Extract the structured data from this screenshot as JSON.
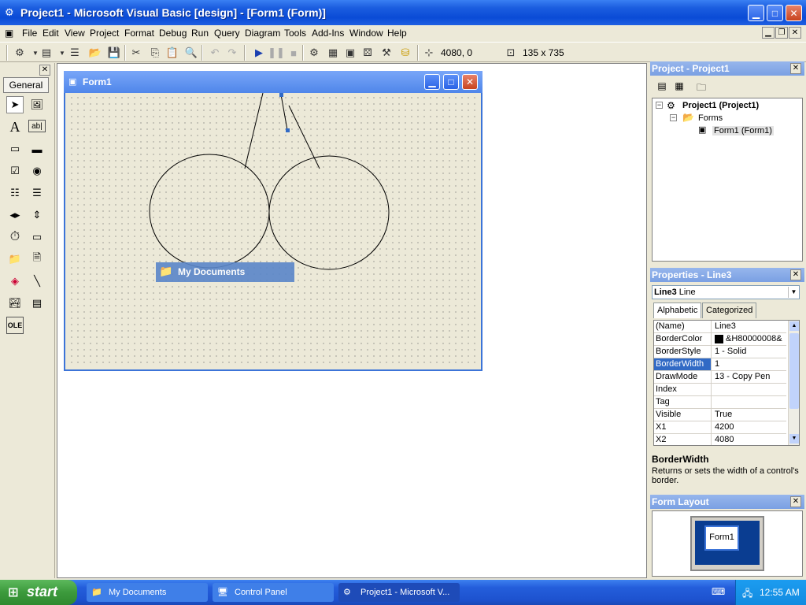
{
  "window": {
    "title": "Project1 - Microsoft Visual Basic [design] - [Form1 (Form)]"
  },
  "menu": [
    "File",
    "Edit",
    "View",
    "Project",
    "Format",
    "Debug",
    "Run",
    "Query",
    "Diagram",
    "Tools",
    "Add-Ins",
    "Window",
    "Help"
  ],
  "toolbar": {
    "position_readout": "4080, 0",
    "size_readout": "135 x 735"
  },
  "toolbox": {
    "tab_label": "General"
  },
  "form": {
    "title": "Form1",
    "desktop_item_label": "My Documents"
  },
  "project_explorer": {
    "title": "Project - Project1",
    "nodes": [
      "Project1 (Project1)",
      "Forms",
      "Form1 (Form1)"
    ]
  },
  "properties": {
    "title": "Properties - Line3",
    "object_name": "Line3",
    "object_type": "Line",
    "tabs": [
      "Alphabetic",
      "Categorized"
    ],
    "rows": [
      {
        "name": "(Name)",
        "value": "Line3"
      },
      {
        "name": "BorderColor",
        "value": "&H80000008&"
      },
      {
        "name": "BorderStyle",
        "value": "1 - Solid"
      },
      {
        "name": "BorderWidth",
        "value": "1"
      },
      {
        "name": "DrawMode",
        "value": "13 - Copy Pen"
      },
      {
        "name": "Index",
        "value": ""
      },
      {
        "name": "Tag",
        "value": ""
      },
      {
        "name": "Visible",
        "value": "True"
      },
      {
        "name": "X1",
        "value": "4200"
      },
      {
        "name": "X2",
        "value": "4080"
      }
    ],
    "selected_row": 3,
    "description_title": "BorderWidth",
    "description_text": "Returns or sets the width of a control's border."
  },
  "form_layout": {
    "title": "Form Layout",
    "form_label": "Form1"
  },
  "taskbar": {
    "start_label": "start",
    "tasks": [
      "My Documents",
      "Control Panel",
      "Project1 - Microsoft V..."
    ],
    "clock": "12:55 AM"
  },
  "colors": {
    "titlebar": "#0a4bd6",
    "taskbar": "#245edb",
    "selection": "#316ac5"
  }
}
